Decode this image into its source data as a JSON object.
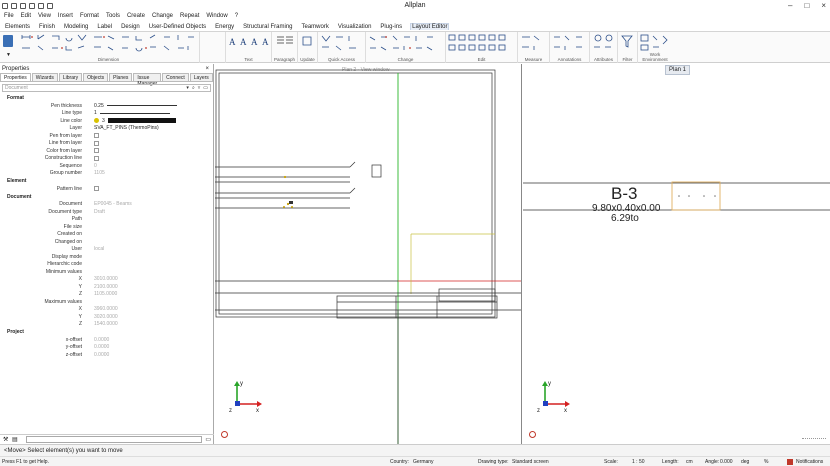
{
  "window": {
    "title": "Allplan"
  },
  "menu": [
    "File",
    "Edit",
    "View",
    "Insert",
    "Format",
    "Tools",
    "Create",
    "Change",
    "Repeat",
    "Window",
    "?"
  ],
  "ribbon_tabs": [
    {
      "label": "Elements"
    },
    {
      "label": "Finish"
    },
    {
      "label": "Modeling"
    },
    {
      "label": "Label"
    },
    {
      "label": "Design"
    },
    {
      "label": "User-Defined Objects"
    },
    {
      "label": "Energy"
    },
    {
      "label": "Structural Framing"
    },
    {
      "label": "Teamwork"
    },
    {
      "label": "Visualization"
    },
    {
      "label": "Plug-ins"
    },
    {
      "label": "Layout Editor",
      "active": true
    }
  ],
  "ribbon_groups": [
    "Dimension",
    "Text",
    "Paragraph",
    "Update",
    "Quick Access",
    "Change",
    "Edit",
    "Measure",
    "Annotations",
    "Attributes",
    "Filter",
    "Work Environment"
  ],
  "properties": {
    "title": "Properties",
    "tabs": [
      {
        "label": "Properties",
        "active": true
      },
      {
        "label": "Wizards"
      },
      {
        "label": "Library"
      },
      {
        "label": "Objects"
      },
      {
        "label": "Planes"
      },
      {
        "label": "Issue Manager"
      },
      {
        "label": "Connect"
      },
      {
        "label": "Layers"
      }
    ],
    "selector": "Document",
    "sections": {
      "format": "Format",
      "element": "Element",
      "document": "Document",
      "project": "Project"
    },
    "format_rows": [
      {
        "label": "Pen thickness",
        "value": "0.25"
      },
      {
        "label": "Line type",
        "value": "1"
      },
      {
        "label": "Line color",
        "value": "3"
      },
      {
        "label": "Layer",
        "value": "SVA_FT_PINS (ThermoPins)"
      },
      {
        "label": "Pen from layer",
        "value": ""
      },
      {
        "label": "Line from layer",
        "value": ""
      },
      {
        "label": "Color from layer",
        "value": ""
      },
      {
        "label": "Construction line",
        "value": ""
      },
      {
        "label": "Sequence",
        "value": "0"
      },
      {
        "label": "Group number",
        "value": "1105"
      }
    ],
    "element_rows": [
      {
        "label": "Pattern line",
        "value": ""
      }
    ],
    "document_rows": [
      {
        "label": "Document",
        "value": "EP0045 - Beams"
      },
      {
        "label": "Document type",
        "value": "Draft"
      },
      {
        "label": "Path",
        "value": ""
      },
      {
        "label": "File size",
        "value": ""
      },
      {
        "label": "Created on",
        "value": ""
      },
      {
        "label": "Changed on",
        "value": ""
      },
      {
        "label": "User",
        "value": "local"
      },
      {
        "label": "Display mode",
        "value": ""
      },
      {
        "label": "Hierarchic code",
        "value": ""
      },
      {
        "label": "Minimum values",
        "value": ""
      },
      {
        "label": "X",
        "value": "3010.0000"
      },
      {
        "label": "Y",
        "value": "2100.0000"
      },
      {
        "label": "Z",
        "value": "1105.0000"
      },
      {
        "label": "Maximum values",
        "value": ""
      },
      {
        "label": "X",
        "value": "3960.0000"
      },
      {
        "label": "Y",
        "value": "3020.0000"
      },
      {
        "label": "Z",
        "value": "1540.0000"
      }
    ],
    "project_rows": [
      {
        "label": "x-offset",
        "value": "0.0000"
      },
      {
        "label": "y-offset",
        "value": "0.0000"
      },
      {
        "label": "z-offset",
        "value": "0.0000"
      }
    ]
  },
  "viewport1": {
    "label": "Plan 2 - View window"
  },
  "viewport2": {
    "tab": "Plan 1",
    "beam_label": "B-3",
    "beam_dims": "9.80x0.40x0.00",
    "beam_weight": "6.29to"
  },
  "status": {
    "prompt": "<Move> Select element(s) you want to move"
  },
  "infobar": {
    "help": "Press F1 to get Help.",
    "country_label": "Country:",
    "country": "Germany",
    "drawing_type_label": "Drawing type:",
    "drawing_type": "Standard screen",
    "scale_label": "Scale:",
    "scale": "1 : 50",
    "length_label": "Length:",
    "length_unit": "cm",
    "angle_label": "Angle:",
    "angle": "0.000",
    "angle_unit": "deg",
    "percent": "% ",
    "notifications": "Notifications"
  },
  "colors": {
    "accent": "#1e5aa8",
    "axis_x": "#d42020",
    "axis_y": "#2aa52a",
    "axis_z": "#2040c0"
  }
}
